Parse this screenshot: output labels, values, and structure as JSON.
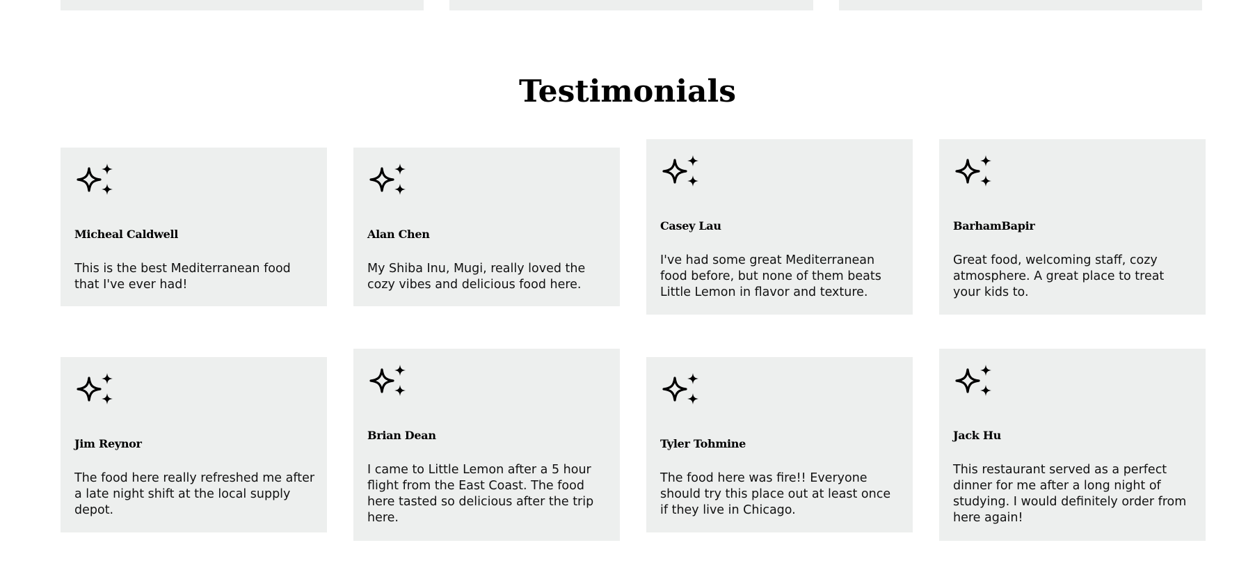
{
  "section": {
    "title": "Testimonials"
  },
  "icons": {
    "rating": "sparkles-icon"
  },
  "colors": {
    "card_background": "#edefee",
    "text": "#111111"
  },
  "testimonials": [
    {
      "name": "Micheal Caldwell",
      "review": "This is the best Mediterranean food that I've ever had!"
    },
    {
      "name": "Alan Chen",
      "review": "My Shiba Inu, Mugi, really loved the cozy vibes and delicious food here."
    },
    {
      "name": "Casey Lau",
      "review": "I've had some great Mediterranean food before, but none of them beats Little Lemon in flavor and texture."
    },
    {
      "name": "BarhamBapir",
      "review": "Great food, welcoming staff, cozy atmosphere. A great place to treat your kids to."
    },
    {
      "name": "Jim Reynor",
      "review": "The food here really refreshed me after a late night shift at the local supply depot."
    },
    {
      "name": "Brian Dean",
      "review": "I came to Little Lemon after a 5 hour flight from the East Coast. The food here tasted so delicious after the trip here."
    },
    {
      "name": "Tyler Tohmine",
      "review": "The food here was fire!! Everyone should try this place out at least once if they live in Chicago."
    },
    {
      "name": "Jack Hu",
      "review": "This restaurant served as a perfect dinner for me after a long night of studying. I would definitely order from here again!"
    }
  ]
}
